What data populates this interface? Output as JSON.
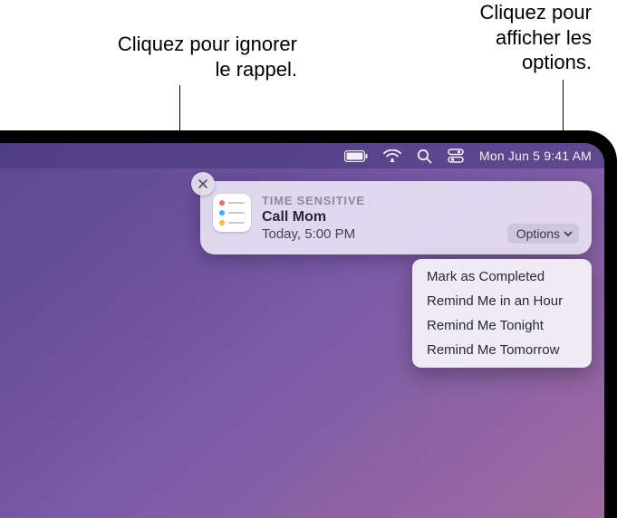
{
  "callouts": {
    "dismiss": "Cliquez pour ignorer le rappel.",
    "options": "Cliquez pour afficher les options."
  },
  "menubar": {
    "clock": "Mon Jun 5  9:41 AM"
  },
  "notification": {
    "label": "TIME SENSITIVE",
    "title": "Call Mom",
    "subtitle": "Today, 5:00 PM",
    "options_button": "Options"
  },
  "options_menu": {
    "items": [
      "Mark as Completed",
      "Remind Me in an Hour",
      "Remind Me Tonight",
      "Remind Me Tomorrow"
    ]
  },
  "icon_colors": {
    "reminders_dots": [
      "#ff6a5c",
      "#3fa8ff",
      "#ffb63f"
    ]
  }
}
